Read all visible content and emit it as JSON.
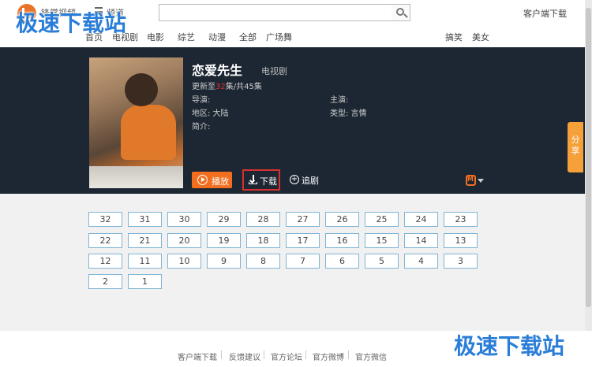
{
  "header": {
    "logo_text": "锋掌视频",
    "channel_label": "频道",
    "search": {
      "placeholder": ""
    },
    "client_download": "客户端下载",
    "nav": [
      "首页",
      "电视剧",
      "电影",
      "综艺",
      "动漫",
      "全部",
      "广场舞"
    ],
    "nav_right": [
      "搞笑",
      "美女"
    ]
  },
  "show": {
    "title": "恋爱先生",
    "type": "电视剧",
    "update_prefix": "更新至",
    "update_current": "32",
    "update_suffix": "集/共45集",
    "director": "导演:",
    "cast": "主演:",
    "region": "地区: 大陆",
    "genre": "类型: 言情",
    "intro": "简介:",
    "play_label": "播放",
    "download_label": "下载",
    "follow_label": "追剧",
    "share_label": "分享"
  },
  "episodes": [
    "32",
    "31",
    "30",
    "29",
    "28",
    "27",
    "26",
    "25",
    "24",
    "23",
    "22",
    "21",
    "20",
    "19",
    "18",
    "17",
    "16",
    "15",
    "14",
    "13",
    "12",
    "11",
    "10",
    "9",
    "8",
    "7",
    "6",
    "5",
    "4",
    "3",
    "2",
    "1"
  ],
  "footer": {
    "links": [
      "客户端下载",
      "反馈建议",
      "官方论坛",
      "官方微博",
      "官方微信"
    ]
  },
  "watermark": {
    "top": "极速下载站",
    "bottom": "极速下载站"
  },
  "colors": {
    "accent": "#f36f20",
    "banner_bg": "#1c2733",
    "highlight_border": "#d83030",
    "episode_border": "#7fb4d6"
  }
}
